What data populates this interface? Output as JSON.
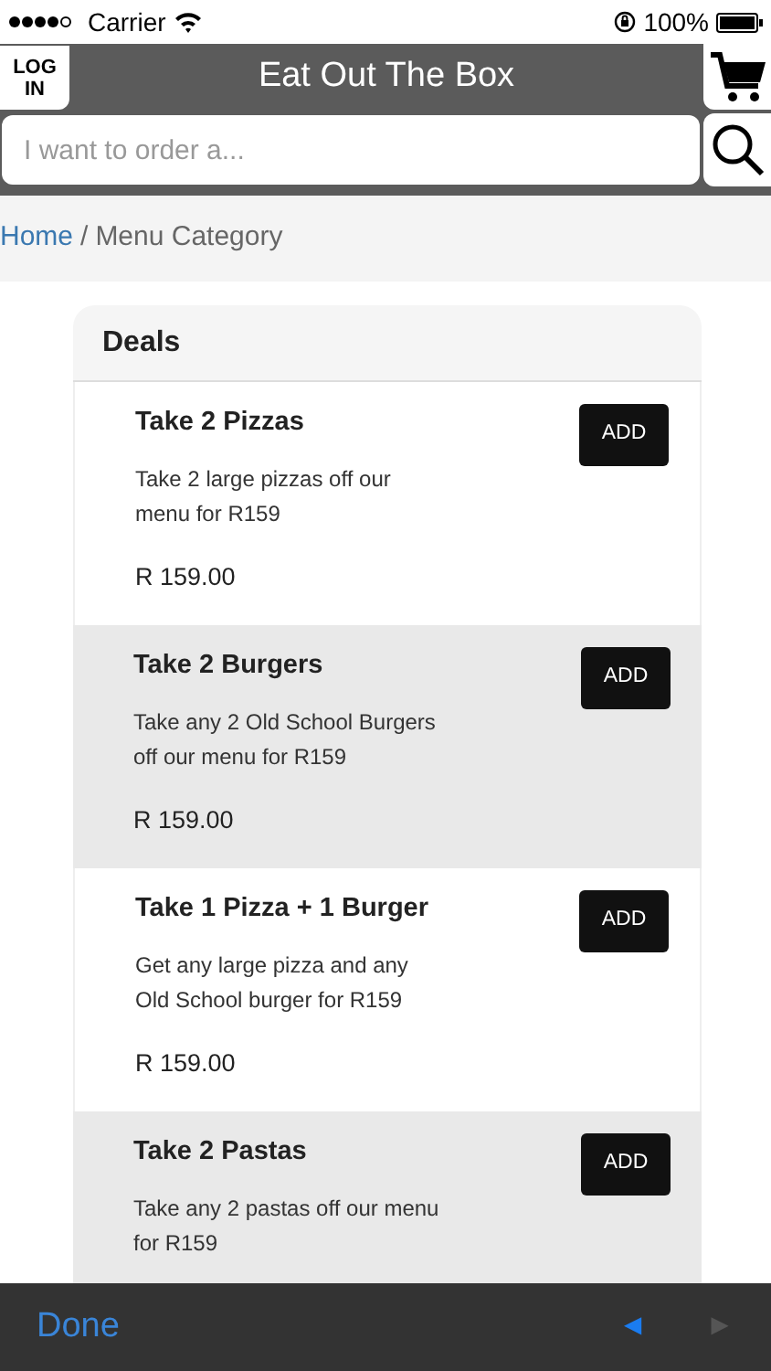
{
  "status_bar": {
    "carrier": "Carrier",
    "battery": "100%"
  },
  "header": {
    "login": "LOG IN",
    "title": "Eat Out The Box"
  },
  "search": {
    "placeholder": "I want to order a..."
  },
  "breadcrumb": {
    "home": "Home",
    "separator": "/",
    "current": "Menu Category"
  },
  "category": {
    "title": "Deals",
    "items": [
      {
        "name": "Take 2 Pizzas",
        "description": "Take 2 large pizzas off our menu for R159",
        "price": "R 159.00",
        "button": "ADD"
      },
      {
        "name": "Take 2 Burgers",
        "description": "Take any 2 Old School Burgers off our menu for R159",
        "price": "R 159.00",
        "button": "ADD"
      },
      {
        "name": "Take 1 Pizza + 1 Burger",
        "description": "Get any large pizza and any Old School burger for R159",
        "price": "R 159.00",
        "button": "ADD"
      },
      {
        "name": "Take 2 Pastas",
        "description": "Take any 2 pastas off our menu for R159",
        "button": "ADD"
      }
    ]
  },
  "keyboard_bar": {
    "done": "Done",
    "previous": {
      "label": "◄",
      "disabled": false
    },
    "next": {
      "label": "►",
      "disabled": true
    }
  }
}
